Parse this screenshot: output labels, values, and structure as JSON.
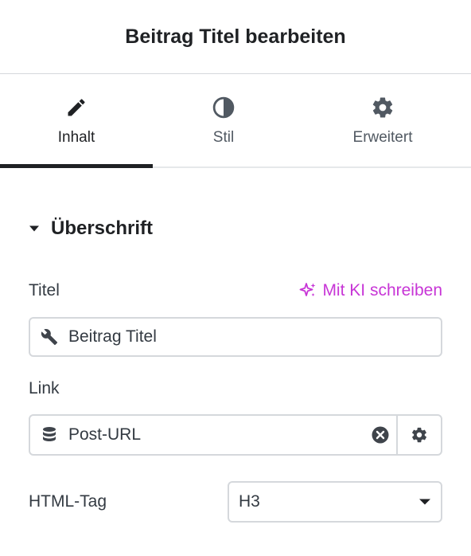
{
  "header": {
    "title": "Beitrag Titel bearbeiten"
  },
  "tabs": [
    {
      "label": "Inhalt",
      "icon": "pencil-icon",
      "active": true
    },
    {
      "label": "Stil",
      "icon": "contrast-icon",
      "active": false
    },
    {
      "label": "Erweitert",
      "icon": "gear-icon",
      "active": false
    }
  ],
  "section": {
    "title": "Überschrift",
    "expanded": true
  },
  "title_field": {
    "label": "Titel",
    "ai_link": "Mit KI schreiben",
    "value": "Beitrag Titel",
    "icon": "wrench-icon"
  },
  "link_field": {
    "label": "Link",
    "value": "Post-URL",
    "icon": "database-icon"
  },
  "html_tag": {
    "label": "HTML-Tag",
    "selected": "H3"
  },
  "colors": {
    "text": "#1f2124",
    "muted": "#515962",
    "border": "#d5d8dc",
    "accent_ai": "#c735d6"
  }
}
